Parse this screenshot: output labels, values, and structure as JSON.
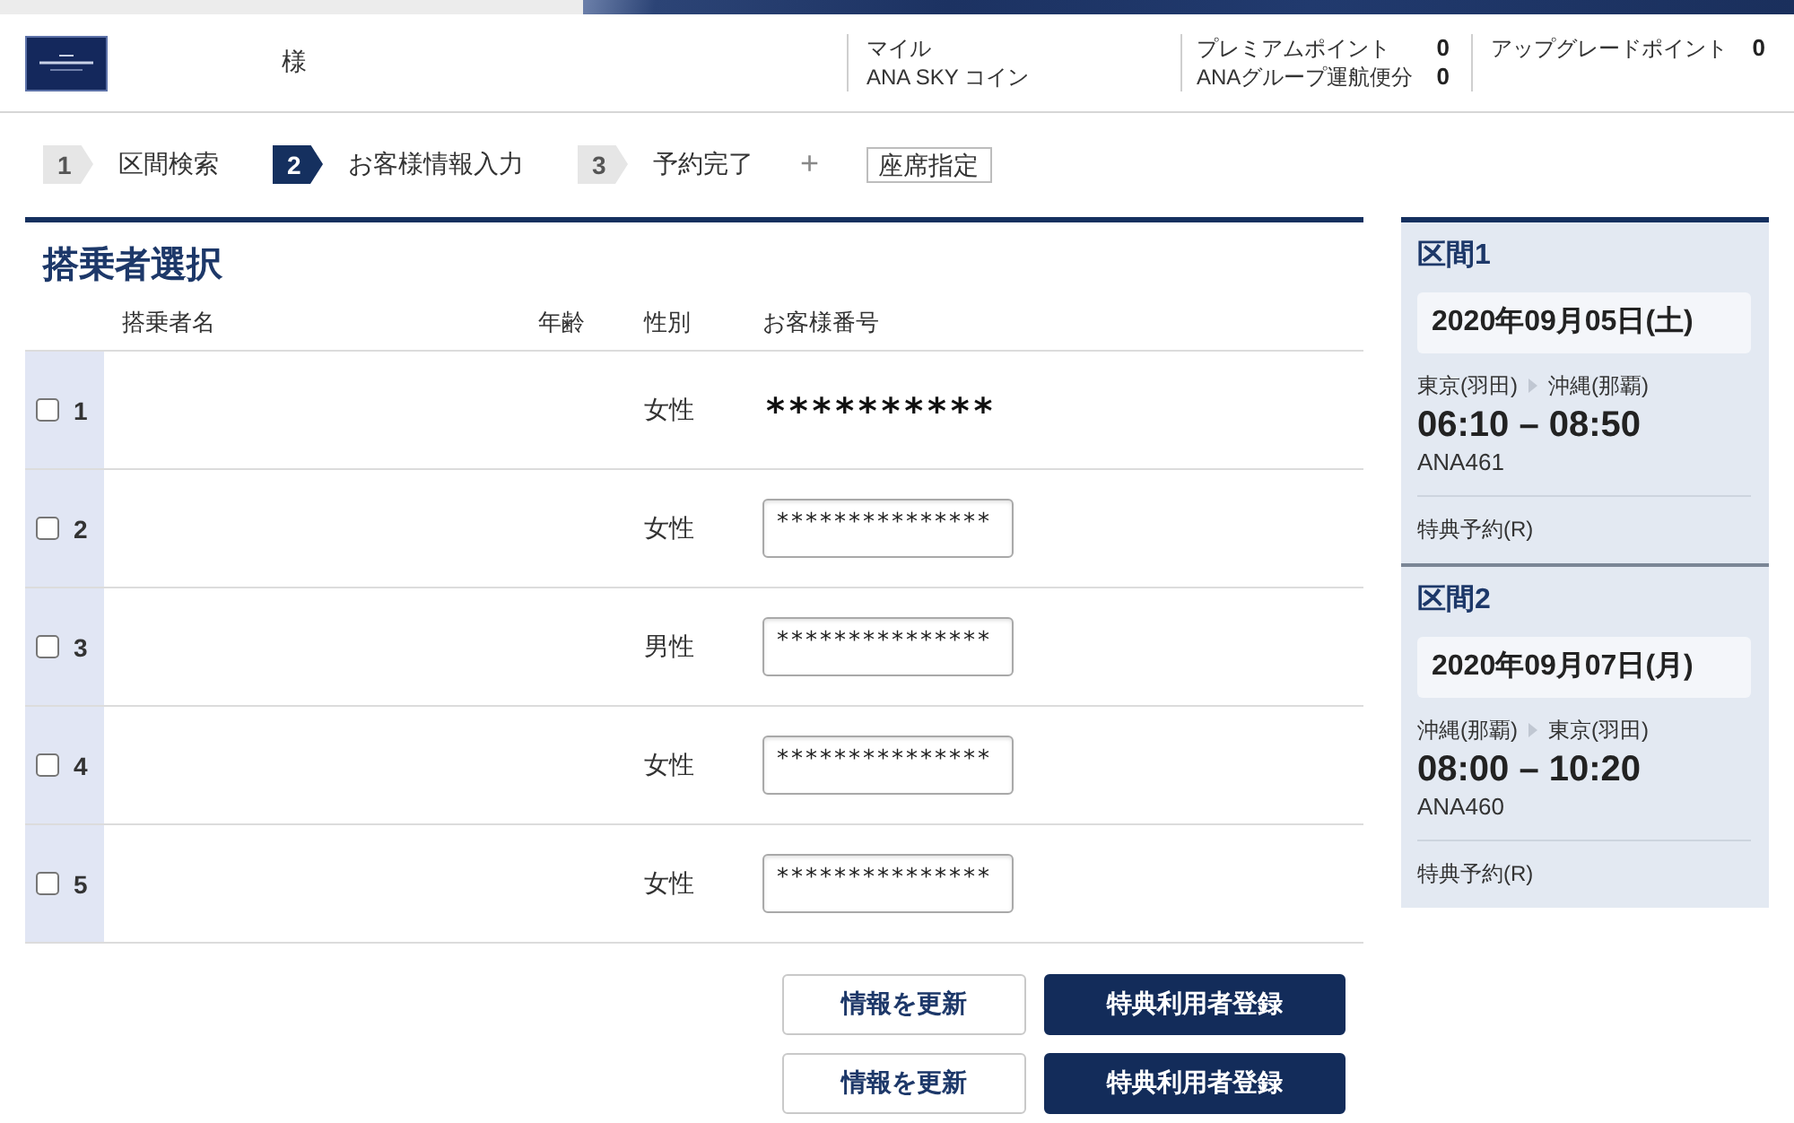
{
  "header": {
    "honorific": "様",
    "miles": {
      "label": "マイル",
      "sub_label": "ANA SKY コイン"
    },
    "premium_points": {
      "label": "プレミアムポイント",
      "value": "0",
      "group_label": "ANAグループ運航便分",
      "group_value": "0"
    },
    "upgrade_points": {
      "label": "アップグレードポイント",
      "value": "0"
    }
  },
  "steps": [
    {
      "number": "1",
      "label": "区間検索",
      "selected": false
    },
    {
      "number": "2",
      "label": "お客様情報入力",
      "selected": true
    },
    {
      "number": "3",
      "label": "予約完了",
      "selected": false
    }
  ],
  "step_extra": {
    "plus": "+",
    "label": "座席指定"
  },
  "passengers": {
    "title": "搭乗者選択",
    "columns": [
      "搭乗者名",
      "年齢",
      "性別",
      "お客様番号"
    ],
    "rows": [
      {
        "number": "1",
        "checked": false,
        "gender": "女性",
        "kind": "text",
        "customer_number": "**********"
      },
      {
        "number": "2",
        "checked": false,
        "gender": "女性",
        "kind": "input",
        "customer_number": "***************"
      },
      {
        "number": "3",
        "checked": false,
        "gender": "男性",
        "kind": "input",
        "customer_number": "***************"
      },
      {
        "number": "4",
        "checked": false,
        "gender": "女性",
        "kind": "input",
        "customer_number": "***************"
      },
      {
        "number": "5",
        "checked": false,
        "gender": "女性",
        "kind": "input",
        "customer_number": "***************"
      }
    ]
  },
  "button_rows": [
    {
      "buttons": [
        {
          "label": "情報を更新",
          "kind": "secondary"
        },
        {
          "label": "特典利用者登録",
          "kind": "primary"
        }
      ]
    },
    {
      "buttons": [
        {
          "label": "情報を更新",
          "kind": "secondary"
        },
        {
          "label": "特典利用者登録",
          "kind": "primary"
        }
      ]
    }
  ],
  "segments": [
    {
      "title": "区間1",
      "date": "2020年09月05日(土)",
      "origin": "東京(羽田)",
      "destination": "沖縄(那覇)",
      "time": "06:10 – 08:50",
      "flight": "ANA461",
      "fare": "特典予約(R)"
    },
    {
      "title": "区間2",
      "date": "2020年09月07日(月)",
      "origin": "沖縄(那覇)",
      "destination": "東京(羽田)",
      "time": "08:00 – 10:20",
      "flight": "ANA460",
      "fare": "特典予約(R)"
    }
  ]
}
